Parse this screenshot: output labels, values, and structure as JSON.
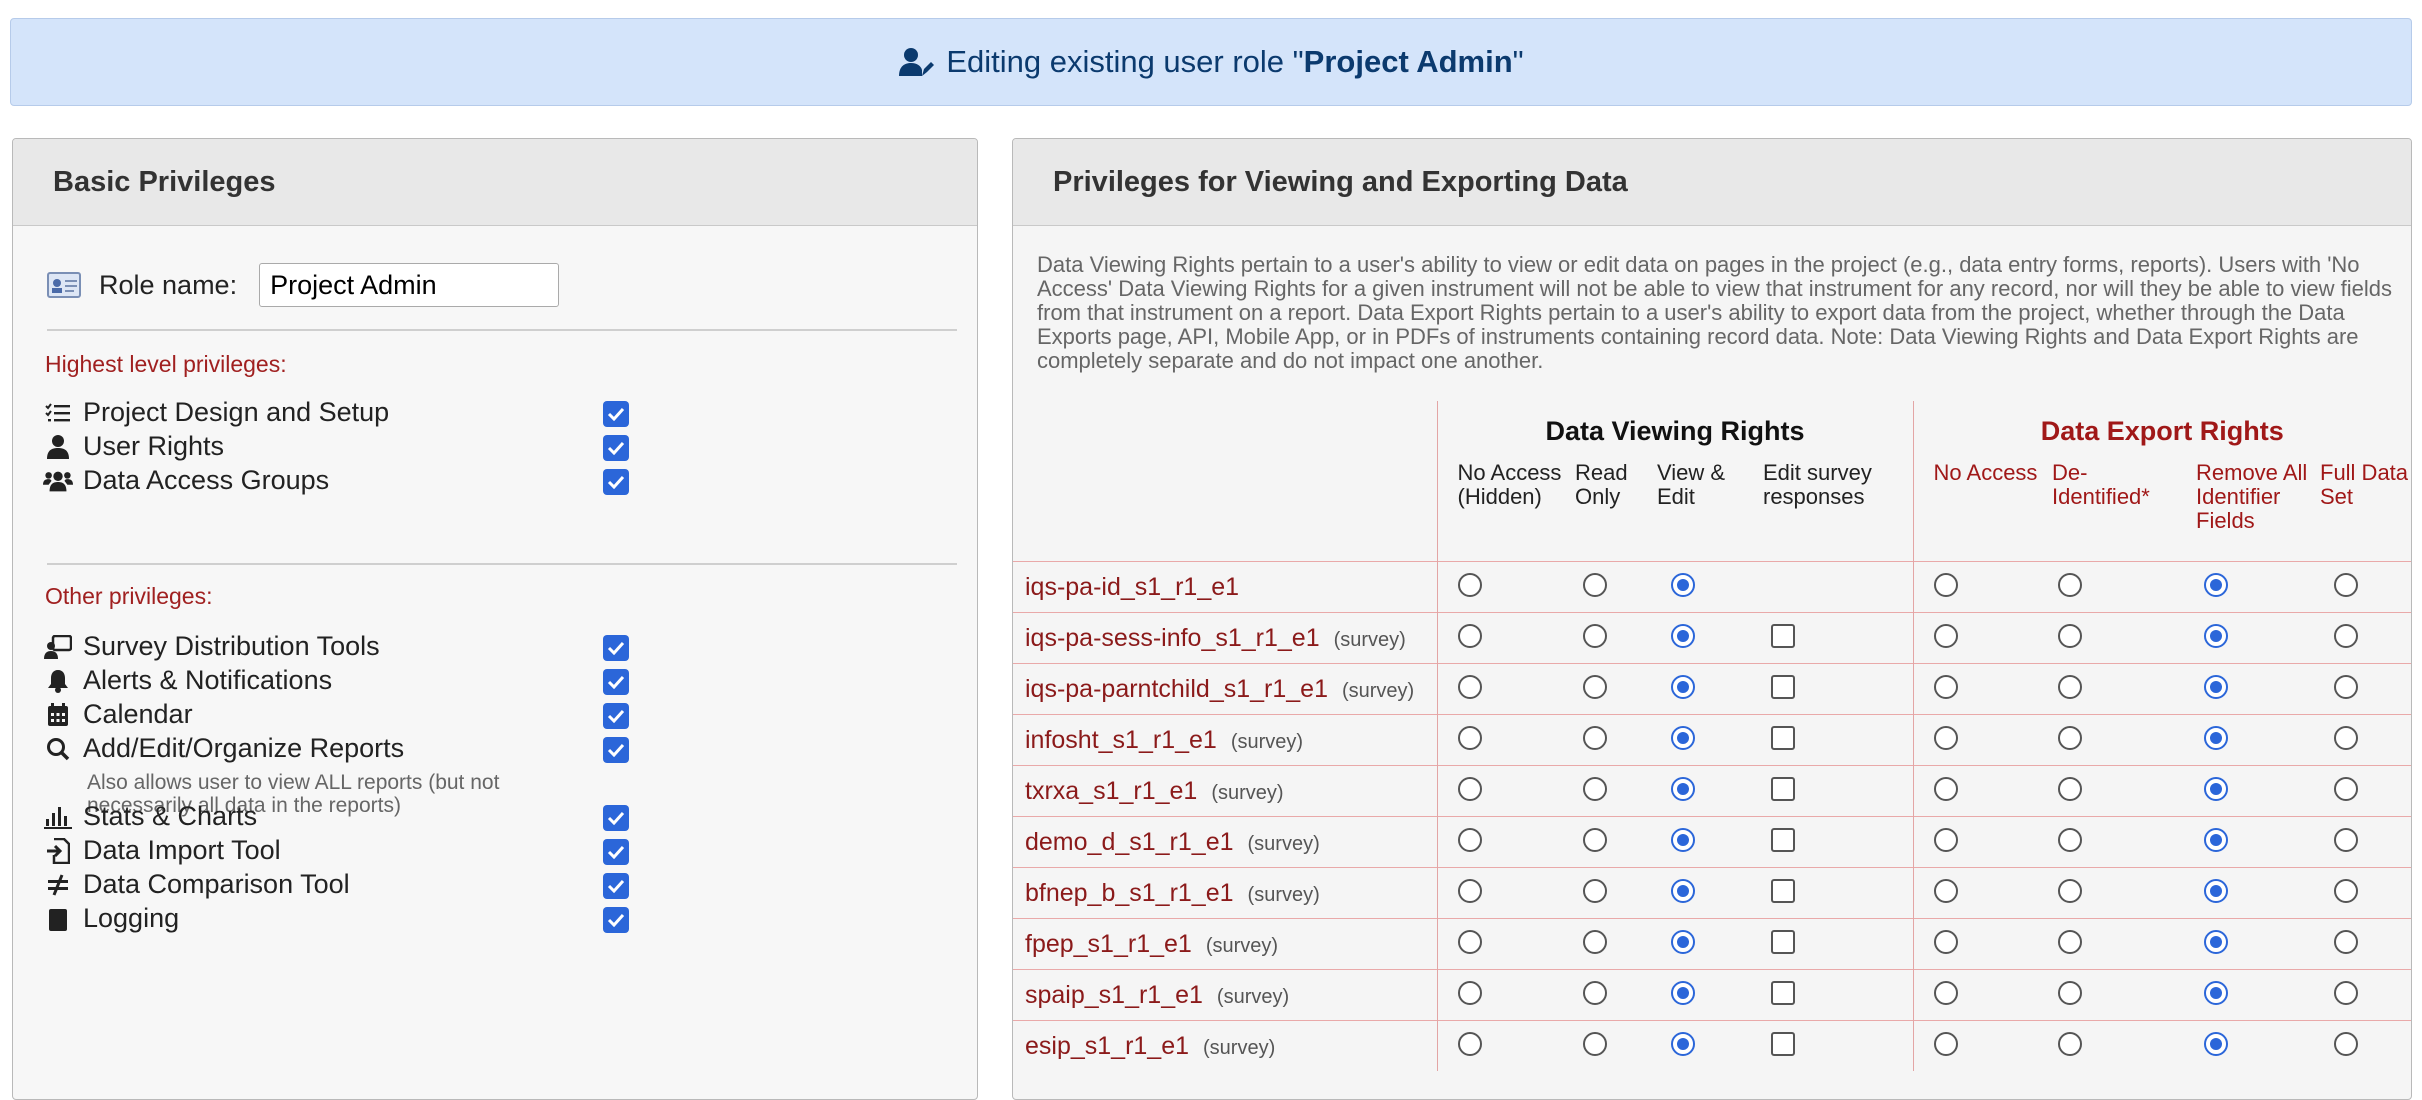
{
  "banner": {
    "prefix": "Editing existing user role \"",
    "role": "Project Admin",
    "suffix": "\""
  },
  "left_panel": {
    "title": "Basic Privileges",
    "role_label": "Role name:",
    "role_value": "Project Admin",
    "highest_label": "Highest level privileges:",
    "highest": [
      {
        "label": "Project Design and Setup",
        "icon": "checklist-icon",
        "checked": true
      },
      {
        "label": "User Rights",
        "icon": "user-icon",
        "checked": true
      },
      {
        "label": "Data Access Groups",
        "icon": "users-icon",
        "checked": true
      }
    ],
    "other_label": "Other privileges:",
    "other": [
      {
        "label": "Survey Distribution Tools",
        "icon": "survey-icon",
        "checked": true
      },
      {
        "label": "Alerts & Notifications",
        "icon": "bell-icon",
        "checked": true
      },
      {
        "label": "Calendar",
        "icon": "calendar-icon",
        "checked": true
      },
      {
        "label": "Add/Edit/Organize Reports",
        "icon": "search-icon",
        "checked": true,
        "sub": "Also allows user to view ALL reports (but not necessarily all data in the reports)"
      },
      {
        "label": "Stats & Charts",
        "icon": "chart-icon",
        "checked": true
      },
      {
        "label": "Data Import Tool",
        "icon": "import-icon",
        "checked": true
      },
      {
        "label": "Data Comparison Tool",
        "icon": "not-equal-icon",
        "checked": true
      },
      {
        "label": "Logging",
        "icon": "log-icon",
        "checked": true
      }
    ]
  },
  "right_panel": {
    "title": "Privileges for Viewing and Exporting Data",
    "description": "Data Viewing Rights pertain to a user's ability to view or edit data on pages in the project (e.g., data entry forms, reports). Users with 'No Access' Data Viewing Rights for a given instrument will not be able to view that instrument for any record, nor will they be able to view fields from that instrument on a report. Data Export Rights pertain to a user's ability to export data from the project, whether through the Data Exports page, API, Mobile App, or in PDFs of instruments containing record data. Note: Data Viewing Rights and Data Export Rights are completely separate and do not impact one another.",
    "viewing_title": "Data Viewing Rights",
    "export_title": "Data Export Rights",
    "viewing_cols": [
      "No Access (Hidden)",
      "Read Only",
      "View & Edit",
      "Edit survey responses"
    ],
    "export_cols": [
      "No Access",
      "De-Identified*",
      "Remove All Identifier Fields",
      "Full Data Set"
    ],
    "survey_tag": "(survey)",
    "instruments": [
      {
        "name": "iqs-pa-id_s1_r1_e1",
        "survey": false,
        "view": 2,
        "edit_survey": false,
        "export": 2
      },
      {
        "name": "iqs-pa-sess-info_s1_r1_e1",
        "survey": true,
        "view": 2,
        "edit_survey": false,
        "export": 2
      },
      {
        "name": "iqs-pa-parntchild_s1_r1_e1",
        "survey": true,
        "view": 2,
        "edit_survey": false,
        "export": 2
      },
      {
        "name": "infosht_s1_r1_e1",
        "survey": true,
        "view": 2,
        "edit_survey": false,
        "export": 2
      },
      {
        "name": "txrxa_s1_r1_e1",
        "survey": true,
        "view": 2,
        "edit_survey": false,
        "export": 2
      },
      {
        "name": "demo_d_s1_r1_e1",
        "survey": true,
        "view": 2,
        "edit_survey": false,
        "export": 2
      },
      {
        "name": "bfnep_b_s1_r1_e1",
        "survey": true,
        "view": 2,
        "edit_survey": false,
        "export": 2
      },
      {
        "name": "fpep_s1_r1_e1",
        "survey": true,
        "view": 2,
        "edit_survey": false,
        "export": 2
      },
      {
        "name": "spaip_s1_r1_e1",
        "survey": true,
        "view": 2,
        "edit_survey": false,
        "export": 2
      },
      {
        "name": "esip_s1_r1_e1",
        "survey": true,
        "view": 2,
        "edit_survey": false,
        "export": 2
      }
    ]
  }
}
